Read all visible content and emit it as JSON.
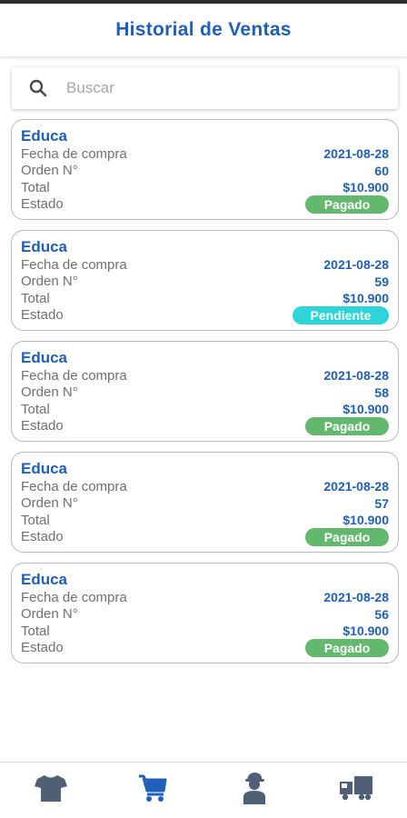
{
  "header": {
    "title": "Historial de Ventas"
  },
  "search": {
    "placeholder": "Buscar"
  },
  "colors": {
    "primary": "#1f5fb7",
    "paid": "#62b86d",
    "pending": "#2ed5d8",
    "icon": "#4f5f75",
    "icon_active": "#1f5fb7"
  },
  "labels": {
    "date": "Fecha de compra",
    "order": "Orden N°",
    "total": "Total",
    "status": "Estado"
  },
  "orders": [
    {
      "title": "Educa",
      "date": "2021-08-28",
      "order": "60",
      "total": "$10.900",
      "status": "Pagado",
      "status_type": "paid"
    },
    {
      "title": "Educa",
      "date": "2021-08-28",
      "order": "59",
      "total": "$10.900",
      "status": "Pendiente",
      "status_type": "pending"
    },
    {
      "title": "Educa",
      "date": "2021-08-28",
      "order": "58",
      "total": "$10.900",
      "status": "Pagado",
      "status_type": "paid"
    },
    {
      "title": "Educa",
      "date": "2021-08-28",
      "order": "57",
      "total": "$10.900",
      "status": "Pagado",
      "status_type": "paid"
    },
    {
      "title": "Educa",
      "date": "2021-08-28",
      "order": "56",
      "total": "$10.900",
      "status": "Pagado",
      "status_type": "paid"
    }
  ],
  "tabs": [
    {
      "icon": "tshirt-icon",
      "active": false
    },
    {
      "icon": "shopping-cart-icon",
      "active": true
    },
    {
      "icon": "person-icon",
      "active": false
    },
    {
      "icon": "truck-icon",
      "active": false
    }
  ]
}
